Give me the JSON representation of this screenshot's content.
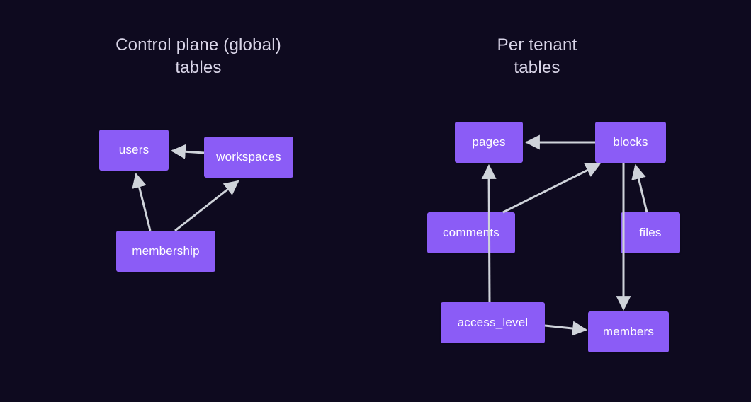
{
  "colors": {
    "background": "#0e0a1f",
    "node_fill": "#8b5cf6",
    "node_text": "#ffffff",
    "title_text": "#d9d5e8",
    "edge": "#cfd3da"
  },
  "left": {
    "title": "Control plane (global)\ntables",
    "nodes": {
      "users": "users",
      "workspaces": "workspaces",
      "membership": "membership"
    },
    "edges": [
      {
        "from": "workspaces",
        "to": "users"
      },
      {
        "from": "membership",
        "to": "users"
      },
      {
        "from": "membership",
        "to": "workspaces"
      }
    ]
  },
  "right": {
    "title": "Per tenant\ntables",
    "nodes": {
      "pages": "pages",
      "blocks": "blocks",
      "comments": "comments",
      "files": "files",
      "access_level": "access_level",
      "members": "members"
    },
    "edges": [
      {
        "from": "blocks",
        "to": "pages"
      },
      {
        "from": "comments",
        "to": "blocks"
      },
      {
        "from": "files",
        "to": "blocks"
      },
      {
        "from": "access_level",
        "to": "pages"
      },
      {
        "from": "access_level",
        "to": "members"
      },
      {
        "from": "blocks",
        "to": "members"
      }
    ]
  }
}
